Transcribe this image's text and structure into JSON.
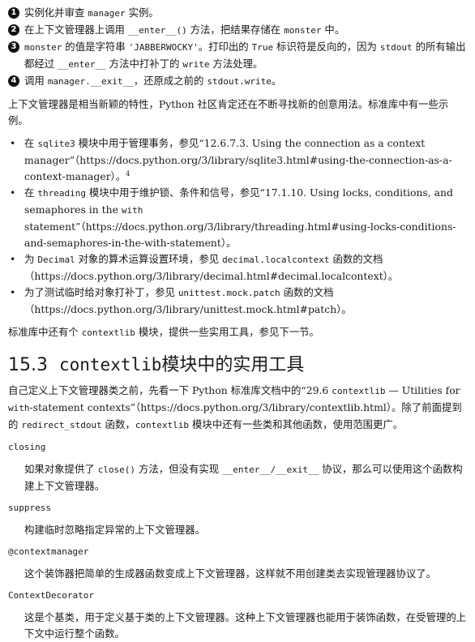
{
  "steps": [
    {
      "num": "1",
      "parts": [
        {
          "t": "实例化并审查 "
        },
        {
          "c": "manager"
        },
        {
          "t": " 实例。"
        }
      ]
    },
    {
      "num": "2",
      "parts": [
        {
          "t": "在上下文管理器上调用 "
        },
        {
          "c": "__enter__()"
        },
        {
          "t": " 方法，把结果存储在 "
        },
        {
          "c": "monster"
        },
        {
          "t": " 中。"
        }
      ]
    },
    {
      "num": "3",
      "parts": [
        {
          "c": "monster"
        },
        {
          "t": " 的值是字符串 "
        },
        {
          "c": "'JABBERWOCKY'"
        },
        {
          "t": "。打印出的 "
        },
        {
          "c": "True"
        },
        {
          "t": " 标识符是反向的，因为 "
        },
        {
          "c": "stdout"
        },
        {
          "t": " 的所有输出都经过 "
        },
        {
          "c": "__enter__"
        },
        {
          "t": " 方法中打补丁的 "
        },
        {
          "c": "write"
        },
        {
          "t": " 方法处理。"
        }
      ]
    },
    {
      "num": "4",
      "parts": [
        {
          "t": "调用 "
        },
        {
          "c": "manager.__exit__"
        },
        {
          "t": "，还原成之前的 "
        },
        {
          "c": "stdout.write"
        },
        {
          "t": "。"
        }
      ]
    }
  ],
  "intro": "上下文管理器是相当新颖的特性，Python 社区肯定还在不断寻找新的创意用法。标准库中有一些示例。",
  "examples": [
    [
      {
        "t": "在 "
      },
      {
        "c": "sqlite3"
      },
      {
        "t": " 模块中用于管理事务，参见“12.6.7.3. Using the connection as a context manager”（https://docs.python.org/3/library/sqlite3.html#using-the-connection-as-a-context-manager）。"
      },
      {
        "s": "4"
      }
    ],
    [
      {
        "t": "在 "
      },
      {
        "c": "threading"
      },
      {
        "t": " 模块中用于维护锁、条件和信号，参见“17.1.10. Using locks, conditions, and semaphores in the "
      },
      {
        "c": "with"
      },
      {
        "t": " statement”（https://docs.python.org/3/library/threading.html#using-locks-conditions-and-semaphores-in-the-with-statement）。"
      }
    ],
    [
      {
        "t": "为 "
      },
      {
        "c": "Decimal"
      },
      {
        "t": " 对象的算术运算设置环境，参见 "
      },
      {
        "c": "decimal.localcontext"
      },
      {
        "t": " 函数的文档（https://docs.python.org/3/library/decimal.html#decimal.localcontext）。"
      }
    ],
    [
      {
        "t": "为了测试临时给对象打补丁，参见 "
      },
      {
        "c": "unittest.mock.patch"
      },
      {
        "t": " 函数的文档（https://docs.python.org/3/library/unittest.mock.html#patch）。"
      }
    ]
  ],
  "closing_para": [
    {
      "t": "标准库中还有个 "
    },
    {
      "c": "contextlib"
    },
    {
      "t": " 模块，提供一些实用工具，参见下一节。"
    }
  ],
  "section": {
    "number": "15.3",
    "mono": "contextlib",
    "text": "模块中的实用工具"
  },
  "section_intro": [
    {
      "t": "自己定义上下文管理器类之前，先看一下 Python 标准库文档中的“29.6 "
    },
    {
      "c": "contextlib"
    },
    {
      "t": " — Utilities for "
    },
    {
      "c": "with"
    },
    {
      "t": "-statement contexts”（https://docs.python.org/3/library/contextlib.html）。除了前面提到的 "
    },
    {
      "c": "redirect_stdout"
    },
    {
      "t": " 函数，"
    },
    {
      "c": "contextlib"
    },
    {
      "t": " 模块中还有一些类和其他函数，使用范围更广。"
    }
  ],
  "terms": [
    {
      "name": "closing",
      "desc": [
        {
          "t": "如果对象提供了 "
        },
        {
          "c": "close()"
        },
        {
          "t": " 方法，但没有实现 "
        },
        {
          "c": "__enter__/__exit__"
        },
        {
          "t": " 协议，那么可以使用这个函数构建上下文管理器。"
        }
      ]
    },
    {
      "name": "suppress",
      "desc": [
        {
          "t": "构建临时忽略指定异常的上下文管理器。"
        }
      ]
    },
    {
      "name": "@contextmanager",
      "desc": [
        {
          "t": "这个装饰器把简单的生成器函数变成上下文管理器，这样就不用创建类去实现管理器协议了。"
        }
      ]
    },
    {
      "name": "ContextDecorator",
      "desc": [
        {
          "t": "这是个基类，用于定义基于类的上下文管理器。这种上下文管理器也能用于装饰函数，在受管理的上下文中运行整个函数。"
        }
      ]
    }
  ]
}
